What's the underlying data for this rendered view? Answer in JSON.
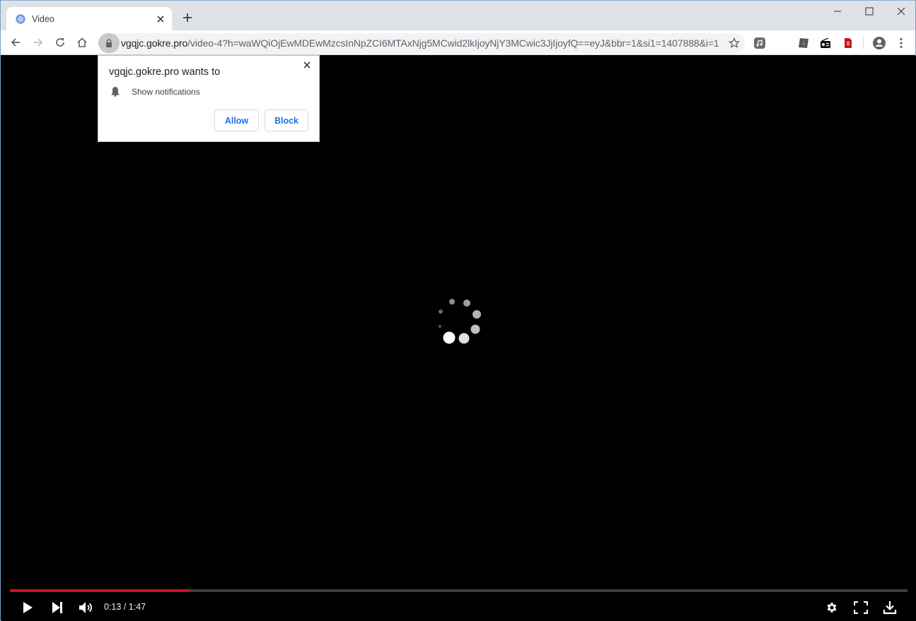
{
  "browser": {
    "tab": {
      "title": "Video",
      "favicon": "globe-favicon-icon"
    },
    "new_tab_icon": "plus-icon",
    "window_controls": [
      "minimize-icon",
      "maximize-icon",
      "close-icon"
    ],
    "toolbar": {
      "back_icon": "arrow-left-icon",
      "forward_icon": "arrow-right-icon",
      "reload_icon": "reload-icon",
      "home_icon": "home-icon",
      "url_host": "vgqjc.gokre.pro",
      "url_path": "/video-4?h=waWQiOjEwMDEwMzcsInNpZCI6MTAxNjg5MCwid2lkIjoyNjY3MCwic3JjIjoyfQ==eyJ&bbr=1&si1=1407888&i=1",
      "lock_icon": "lock-icon",
      "bookmark_icon": "star-icon",
      "extensions": [
        {
          "name": "music-extension-icon"
        },
        {
          "name": "dark-extension-icon"
        },
        {
          "name": "radio-extension-icon"
        },
        {
          "name": "pdf-extension-icon"
        }
      ],
      "profile_icon": "account-circle-icon",
      "menu_icon": "kebab-menu-icon"
    }
  },
  "permission_popup": {
    "title": "vgqjc.gokre.pro wants to",
    "permission": "Show notifications",
    "permission_icon": "bell-icon",
    "allow_label": "Allow",
    "block_label": "Block"
  },
  "player": {
    "current_time": "0:13",
    "duration": "1:47",
    "time_display": "0:13 / 1:47",
    "progress_fraction": 0.2,
    "state": "loading",
    "controls": [
      "play-icon",
      "skip-next-icon",
      "volume-icon",
      "settings-icon",
      "fullscreen-icon",
      "download-icon"
    ],
    "accent_color": "#cc0f1f"
  }
}
